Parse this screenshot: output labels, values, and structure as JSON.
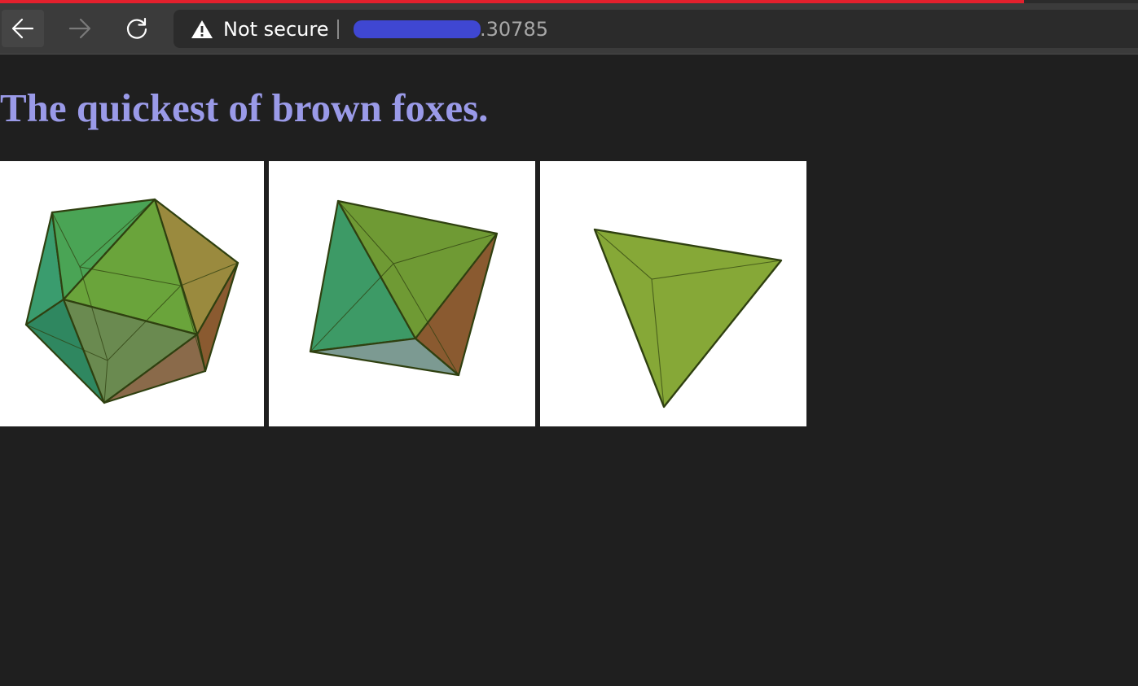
{
  "browser": {
    "security_label": "Not secure",
    "url_visible": ".30785",
    "icons": {
      "back": "arrow-left-icon",
      "forward": "arrow-right-icon",
      "reload": "reload-icon",
      "warning": "warning-triangle-icon"
    },
    "accent_color": "#e3202d"
  },
  "page": {
    "heading": "The quickest of brown foxes.",
    "heading_color": "#9a9ae8",
    "background": "#1f1f1f",
    "images": [
      {
        "name": "icosahedron"
      },
      {
        "name": "octahedron"
      },
      {
        "name": "tetrahedron"
      }
    ]
  }
}
